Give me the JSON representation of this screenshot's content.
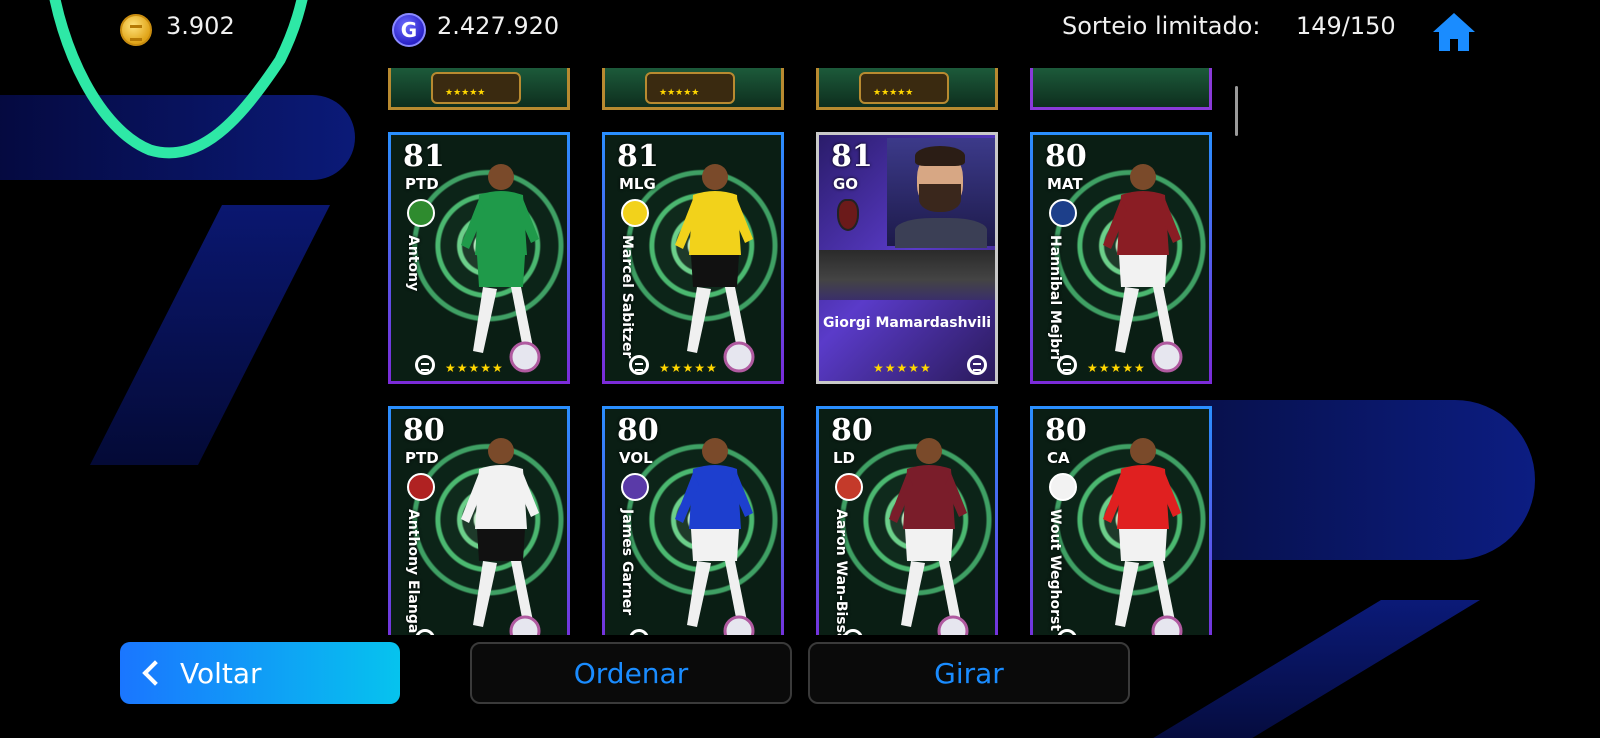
{
  "top_bar": {
    "coins_value": "3.902",
    "gp_symbol": "G",
    "gp_value": "2.427.920",
    "draw_label": "Sorteio limitado:",
    "draw_count": "149/150"
  },
  "icons": {
    "coins": "gold-coin-icon",
    "gp": "gp-icon",
    "home": "home-icon",
    "back": "chevron-left-icon",
    "brand": "efootball-logo-icon"
  },
  "colors": {
    "accent": "#1a8cff",
    "back_button_start": "#1a76ff",
    "back_button_end": "#06c3ee",
    "star": "#ffd600",
    "swoosh": "#2ee8a6"
  },
  "cards": [
    {
      "rating": "81",
      "position": "PTD",
      "name": "Antony",
      "kit": "#1f9a4a",
      "shorts": "#1f9a4a",
      "badge": "#2e8b2e",
      "stars": "★★★★★"
    },
    {
      "rating": "81",
      "position": "MLG",
      "name": "Marcel Sabitzer",
      "kit": "#f2d21b",
      "shorts": "#111111",
      "badge": "#f2d21b",
      "stars": "★★★★★"
    },
    {
      "rating": "81",
      "position": "GO",
      "name": "Giorgi Mamardashvili",
      "stars": "★★★★★",
      "goalkeeper": true
    },
    {
      "rating": "80",
      "position": "MAT",
      "name": "Hannibal Mejbri",
      "kit": "#8a1d24",
      "shorts": "#f2f2f2",
      "badge": "#1d3f8a",
      "stars": "★★★★★"
    },
    {
      "rating": "80",
      "position": "PTD",
      "name": "Anthony Elanga",
      "kit": "#f2f2f2",
      "shorts": "#111111",
      "badge": "#b02222",
      "stars": "★★★★★"
    },
    {
      "rating": "80",
      "position": "VOL",
      "name": "James Garner",
      "kit": "#1d3fcf",
      "shorts": "#f2f2f2",
      "badge": "#5a3aa8",
      "stars": "★★★★★"
    },
    {
      "rating": "80",
      "position": "LD",
      "name": "Aaron Wan-Bissaka",
      "kit": "#7a1d2a",
      "shorts": "#f2f2f2",
      "badge": "#c43a2a",
      "stars": "★★★★★"
    },
    {
      "rating": "80",
      "position": "CA",
      "name": "Wout Weghorst",
      "kit": "#e02020",
      "shorts": "#f2f2f2",
      "badge": "#f2f2f2",
      "stars": "★★★★★"
    }
  ],
  "buttons": {
    "back": "Voltar",
    "sort": "Ordenar",
    "spin": "Girar"
  }
}
